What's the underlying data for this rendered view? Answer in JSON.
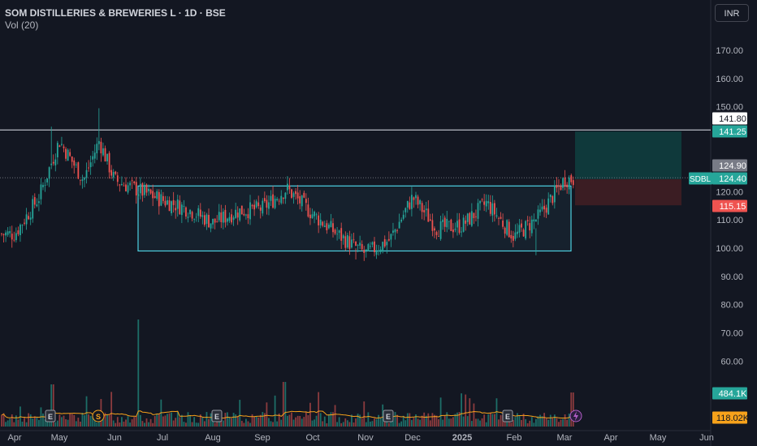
{
  "header": {
    "title": "SOM DISTILLERIES & BREWERIES L · 1D · BSE",
    "volume_label": "Vol (20)",
    "currency": "INR"
  },
  "colors": {
    "background": "#131722",
    "up": "#26a69a",
    "down": "#ef5350",
    "volume_ma": "#f7a21b",
    "range_box": "#4dd0e1",
    "target_zone": "#0f3d3e",
    "stop_zone": "#3d1e24"
  },
  "chart_data": {
    "type": "candlestick",
    "symbol": "SDBL",
    "x_ticks": [
      "Apr",
      "May",
      "Jun",
      "Jul",
      "Aug",
      "Sep",
      "Oct",
      "Nov",
      "Dec",
      "2025",
      "Feb",
      "Mar",
      "Apr",
      "May",
      "Jun"
    ],
    "y_ticks": [
      "170.00",
      "160.00",
      "150.00",
      "120.00",
      "110.00",
      "100.00",
      "90.00",
      "80.00",
      "70.00",
      "60.00"
    ],
    "ylim": [
      55,
      178
    ],
    "price_labels": [
      {
        "text": "141.80",
        "value": 141.8,
        "style": "white"
      },
      {
        "text": "141.25",
        "value": 141.25,
        "style": "green"
      },
      {
        "text": "124.90",
        "value": 124.9,
        "style": "gray"
      },
      {
        "text": "124.40",
        "value": 124.4,
        "style": "green"
      },
      {
        "text": "115.15",
        "value": 115.15,
        "style": "red"
      },
      {
        "text": "484.1K",
        "value": null,
        "style": "green"
      },
      {
        "text": "118.02K",
        "value": null,
        "style": "orange"
      }
    ],
    "horizontal_line": 141.8,
    "last_price": 124.4,
    "range_box": {
      "high": 122,
      "low": 99,
      "start": "Jul",
      "end": "Mar"
    },
    "position": {
      "entry": 124.4,
      "target": 141.25,
      "stop": 115.15
    },
    "event_markers": [
      {
        "label": "E",
        "at": "Apr"
      },
      {
        "label": "S",
        "at": "May"
      },
      {
        "label": "E",
        "at": "Jul"
      },
      {
        "label": "E",
        "at": "Oct"
      },
      {
        "label": "E",
        "at": "Feb"
      }
    ],
    "price_path": [
      {
        "x": "Apr",
        "close": 105
      },
      {
        "x": "Apr-mid",
        "close": 118
      },
      {
        "x": "May",
        "close": 138
      },
      {
        "x": "May-mid",
        "close": 124
      },
      {
        "x": "Jun-early",
        "close": 138
      },
      {
        "x": "Jun",
        "close": 124
      },
      {
        "x": "Jul",
        "close": 117
      },
      {
        "x": "Jul-mid",
        "close": 114
      },
      {
        "x": "Aug",
        "close": 109
      },
      {
        "x": "Aug-mid",
        "close": 113
      },
      {
        "x": "Sep",
        "close": 114
      },
      {
        "x": "Sep-mid",
        "close": 121
      },
      {
        "x": "Oct",
        "close": 112
      },
      {
        "x": "Oct-mid",
        "close": 105
      },
      {
        "x": "Nov",
        "close": 98
      },
      {
        "x": "Nov-mid",
        "close": 103
      },
      {
        "x": "Dec",
        "close": 118
      },
      {
        "x": "Dec-mid",
        "close": 107
      },
      {
        "x": "2025",
        "close": 108
      },
      {
        "x": "2025-mid",
        "close": 116
      },
      {
        "x": "Feb",
        "close": 104
      },
      {
        "x": "Feb-mid",
        "close": 111
      },
      {
        "x": "Mar",
        "close": 124.4
      }
    ]
  }
}
